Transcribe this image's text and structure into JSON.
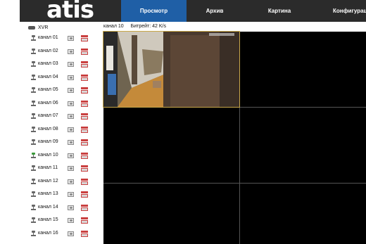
{
  "header": {
    "logo": "atis",
    "tabs": [
      {
        "label": "Просмотр",
        "active": true
      },
      {
        "label": "Архив",
        "active": false
      },
      {
        "label": "Картина",
        "active": false
      },
      {
        "label": "Конфигурация",
        "active": false
      }
    ]
  },
  "sidebar": {
    "device": "XVR",
    "channels": [
      {
        "label": "канал 01",
        "active": false
      },
      {
        "label": "канал 02",
        "active": false
      },
      {
        "label": "канал 03",
        "active": false
      },
      {
        "label": "канал 04",
        "active": false
      },
      {
        "label": "канал 05",
        "active": false
      },
      {
        "label": "канал 06",
        "active": false
      },
      {
        "label": "канал 07",
        "active": false
      },
      {
        "label": "канал 08",
        "active": false
      },
      {
        "label": "канал 09",
        "active": false
      },
      {
        "label": "канал 10",
        "active": true
      },
      {
        "label": "канал 11",
        "active": false
      },
      {
        "label": "канал 12",
        "active": false
      },
      {
        "label": "канал 13",
        "active": false
      },
      {
        "label": "канал 14",
        "active": false
      },
      {
        "label": "канал 15",
        "active": false
      },
      {
        "label": "канал 16",
        "active": false
      }
    ]
  },
  "status": {
    "channel": "канал 10",
    "bitrate": "Битрейт: 42 K/s"
  },
  "colors": {
    "topbar": "#2b2b2b",
    "active_tab": "#1f5fa6",
    "selected_border": "#c8a84a",
    "alarm": "#c94040",
    "channel_active": "#3a9a3a"
  }
}
